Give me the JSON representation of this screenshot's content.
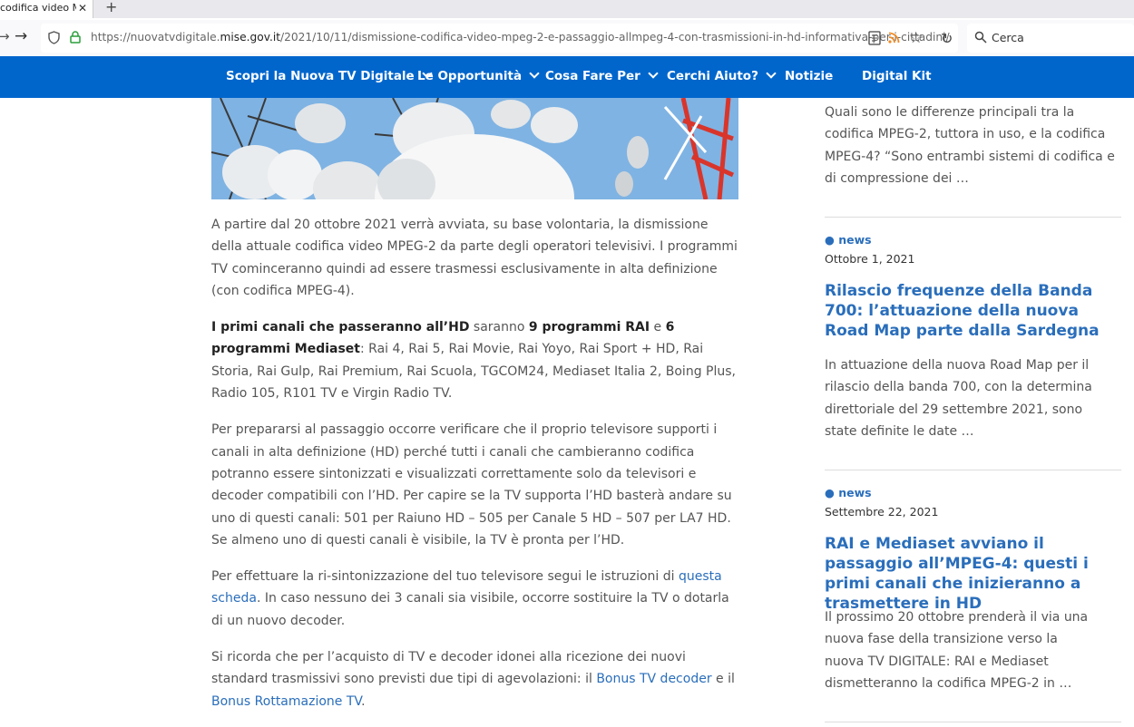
{
  "browser": {
    "tab_title": "codifica video MPEG",
    "url_prefix": "https://nuovatvdigitale.",
    "url_domain": "mise.gov.it",
    "url_path": "/2021/10/11/dismissione-codifica-video-mpeg-2-e-passaggio-allmpeg-4-con-trasmissioni-in-hd-informativa-per-i-cittadini/",
    "search_placeholder": "Cerca"
  },
  "nav": {
    "items": [
      {
        "label": "Scopri la Nuova TV Digitale",
        "dropdown": true
      },
      {
        "label": "Le Opportunità",
        "dropdown": true
      },
      {
        "label": "Cosa Fare Per",
        "dropdown": true
      },
      {
        "label": "Cerchi Aiuto?",
        "dropdown": true
      },
      {
        "label": "Notizie",
        "dropdown": false
      },
      {
        "label": "Digital Kit",
        "dropdown": false
      }
    ],
    "color": "#0066cc"
  },
  "article": {
    "p1": "A partire dal 20 ottobre 2021 verrà avviata, su base volontaria, la dismissione della attuale codifica video MPEG-2 da parte degli operatori televisivi. I programmi TV cominceranno quindi ad essere trasmessi esclusivamente in alta definizione (con codifica MPEG-4).",
    "p2_strong1": "I primi canali che passeranno all’HD",
    "p2_t1": " saranno ",
    "p2_strong2": "9 programmi RAI",
    "p2_t2": " e ",
    "p2_strong3": "6 programmi Mediaset",
    "p2_t3": ": Rai 4, Rai 5, Rai Movie, Rai Yoyo, Rai Sport + HD, Rai Storia, Rai Gulp, Rai Premium, Rai Scuola, TGCOM24, Mediaset Italia 2, Boing Plus, Radio 105, R101 TV e Virgin Radio TV.",
    "p3": "Per prepararsi al passaggio occorre verificare che il proprio televisore supporti i canali in alta definizione (HD) perché tutti i canali che cambieranno codifica potranno essere sintonizzati e visualizzati correttamente solo da televisori e decoder compatibili con l’HD. Per capire se la TV supporta l’HD basterà andare su uno di questi canali: 501 per Raiuno HD – 505 per Canale 5 HD – 507 per LA7 HD. Se almeno uno di questi canali è visibile, la TV è pronta per l’HD.",
    "p4_t1": "Per effettuare la ri-sintonizzazione del tuo televisore segui le istruzioni di ",
    "p4_link": "questa scheda",
    "p4_t2": ". In caso nessuno dei 3 canali sia visibile, occorre sostituire la TV o dotarla di un nuovo decoder.",
    "p5_t1": "Si ricorda che per l’acquisto di TV e decoder idonei alla ricezione dei nuovi standard trasmissivi sono previsti due tipi di agevolazioni: il ",
    "p5_link1": "Bonus TV decoder",
    "p5_t2": " e il ",
    "p5_link2": "Bonus Rottamazione TV",
    "p5_t3": "."
  },
  "sidebar": {
    "top_excerpt": "Quali sono le differenze principali tra la codifica MPEG-2, tuttora in uso, e la codifica MPEG-4? “Sono entrambi sistemi di codifica e di compressione dei …",
    "posts": [
      {
        "badge": "● news",
        "date": "Ottobre 1, 2021",
        "title": "Rilascio frequenze della Banda 700: l’attuazione della nuova Road Map parte dalla Sardegna",
        "excerpt": "In attuazione della nuova Road Map per il rilascio della banda 700, con la determina direttoriale del 29 settembre 2021, sono state definite le date …"
      },
      {
        "badge": "● news",
        "date": "Settembre 22, 2021",
        "title": "RAI e Mediaset avviano il passaggio all’MPEG-4: questi i primi canali che inizieranno a trasmettere in HD",
        "excerpt": "Il prossimo 20 ottobre prenderà il via una nuova fase della transizione verso la nuova TV DIGITALE: RAI e Mediaset dismetteranno la codifica MPEG-2 in …"
      }
    ]
  }
}
